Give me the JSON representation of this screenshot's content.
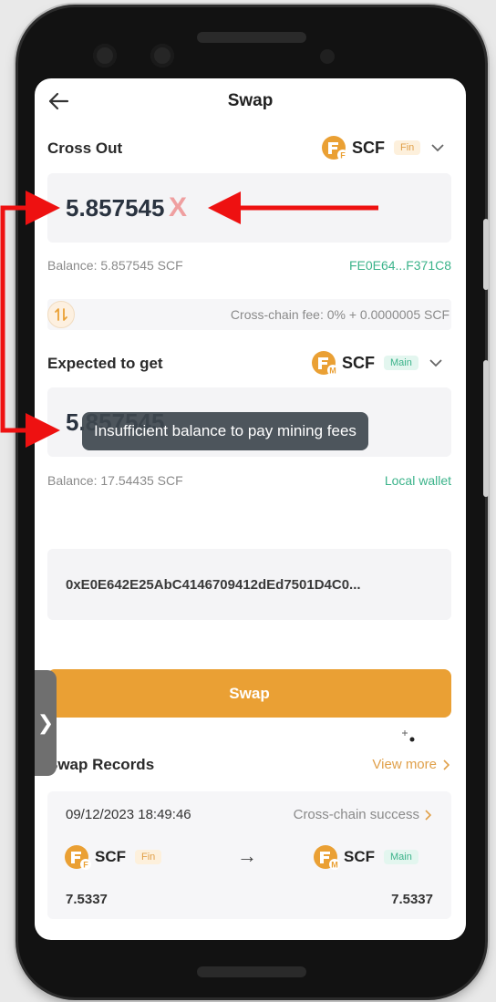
{
  "header": {
    "title": "Swap"
  },
  "cross_out": {
    "label": "Cross Out",
    "token": "SCF",
    "tag": "Fin",
    "icon_letter": "F",
    "amount": "5.857545",
    "clear_mark": "X",
    "balance": "Balance: 5.857545 SCF",
    "address_short": "FE0E64...F371C8"
  },
  "fee": {
    "text": "Cross-chain fee: 0% + 0.0000005 SCF"
  },
  "expected": {
    "label": "Expected to get",
    "token": "SCF",
    "tag": "Main",
    "icon_letter": "M",
    "amount": "5.857545",
    "balance": "Balance: 17.54435 SCF",
    "wallet": "Local wallet"
  },
  "toast": {
    "message": "Insufficient balance to pay mining fees"
  },
  "recipient": {
    "address": "0xE0E642E25AbC4146709412dEd7501D4C0..."
  },
  "swap_button": {
    "label": "Swap"
  },
  "records": {
    "title": "Swap Records",
    "view_more": "View more",
    "items": [
      {
        "datetime": "09/12/2023 18:49:46",
        "status": "Cross-chain success",
        "from_token": "SCF",
        "from_tag": "Fin",
        "to_token": "SCF",
        "to_tag": "Main",
        "arrow": "→",
        "from_amount": "7.5337",
        "to_amount": "7.5337"
      }
    ]
  },
  "side_handle": {
    "glyph": "❯"
  },
  "colors": {
    "accent": "#eaa034",
    "green": "#3bb38a",
    "annotation_red": "#ee1111"
  },
  "icons": [
    "back-arrow-icon",
    "chevron-down-icon",
    "swap-direction-icon",
    "scf-token-icon",
    "chevron-right-icon",
    "arrow-right-icon",
    "mouse-cursor-icon"
  ]
}
